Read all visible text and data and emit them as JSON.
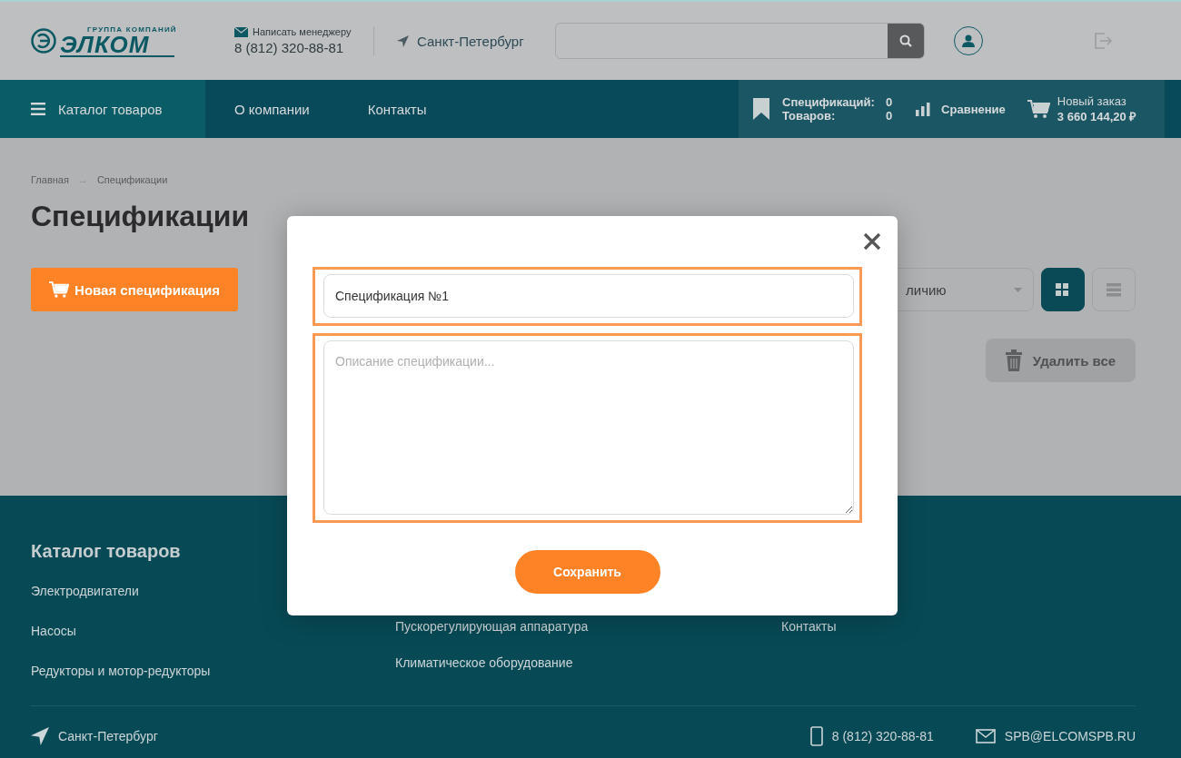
{
  "header": {
    "logo": {
      "tagline": "ГРУППА КОМПАНИЙ",
      "name": "ЭЛКОМ"
    },
    "contact": {
      "label": "Написать менеджеру",
      "phone": "8 (812) 320-88-81"
    },
    "city": "Санкт-Петербург"
  },
  "nav": {
    "items": [
      {
        "label": "Каталог товаров",
        "selected": true
      },
      {
        "label": "О компании",
        "selected": false
      },
      {
        "label": "Контакты",
        "selected": false
      }
    ],
    "counters": [
      {
        "label": "Спецификаций:",
        "value": "0"
      },
      {
        "label": "Товаров:",
        "value": "0"
      }
    ],
    "compare": "Сравнение",
    "cart": {
      "label": "Новый заказ",
      "total": "3 660 144,20 ₽"
    }
  },
  "breadcrumbs": {
    "items": [
      "Главная",
      "Спецификации"
    ],
    "separator": "→"
  },
  "title": "Спецификации",
  "new_button": "Новая спецификация",
  "sort_select": {
    "value": "личию"
  },
  "view_toggle": [
    {
      "kind": "grid",
      "selected": true
    },
    {
      "kind": "list",
      "selected": false
    }
  ],
  "delete_all": "Удалить все",
  "modal": {
    "name_value": "Спецификация №1",
    "description_placeholder": "Описание спецификации...",
    "save": "Сохранить"
  },
  "footer": {
    "heading": "Каталог товаров",
    "columns": [
      [
        "Электродвигатели",
        "Насосы",
        "Редукторы и мотор-редукторы"
      ],
      [
        "Пускорегулирующая аппаратура",
        "Климатическое оборудование"
      ],
      [
        "Контакты"
      ]
    ],
    "city": "Санкт-Петербург",
    "phone": "8 (812) 320-88-81",
    "email": "SPB@ELCOMSPB.RU"
  }
}
